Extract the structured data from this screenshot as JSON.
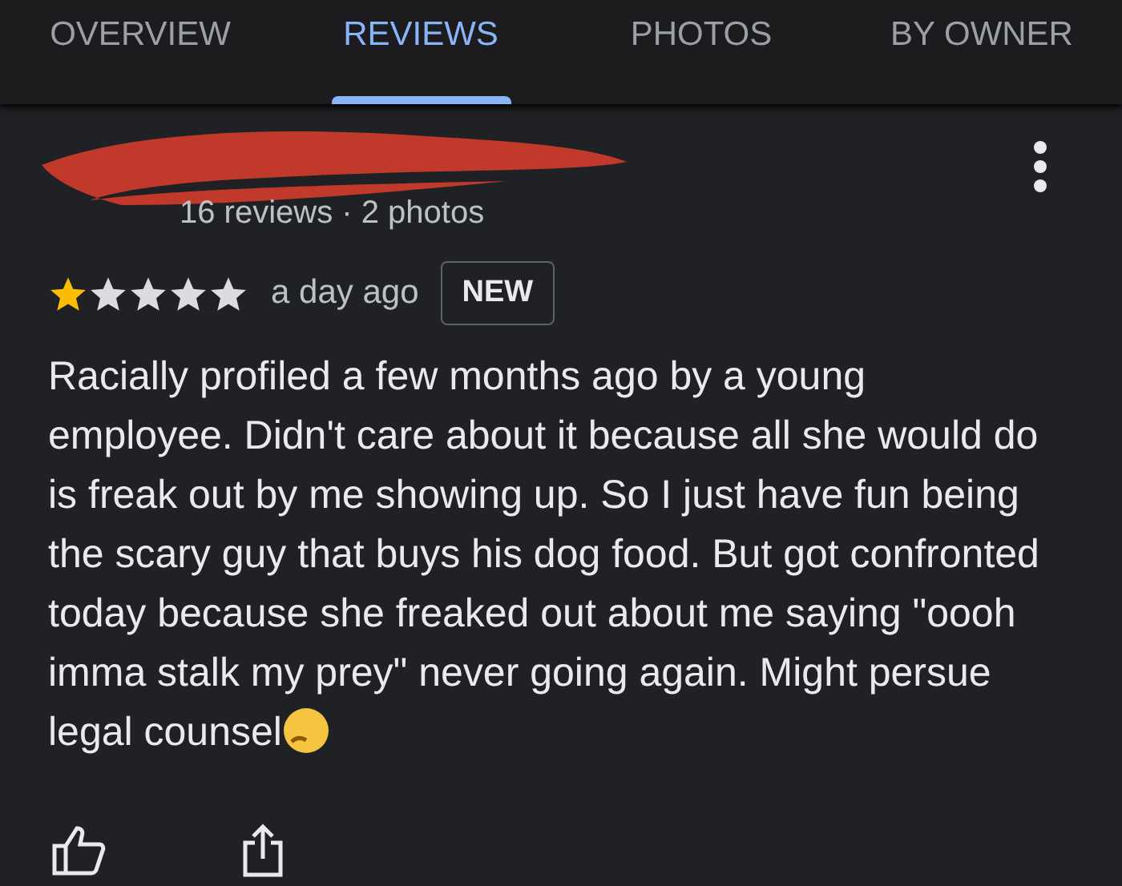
{
  "tabs": [
    {
      "label": "OVERVIEW",
      "selected": false
    },
    {
      "label": "REVIEWS",
      "selected": true
    },
    {
      "label": "PHOTOS",
      "selected": false
    },
    {
      "label": "BY OWNER",
      "selected": false
    }
  ],
  "review": {
    "author_meta": "16 reviews · 2 photos",
    "stars": 1,
    "time": "a day ago",
    "badge": "NEW",
    "text": "Racially profiled a few months ago by a young employee. Didn't care about it because all she would do is freak out by me showing up. So I just have fun being the scary guy that buys his dog food. But got confronted today because she freaked out about me saying \"oooh imma stalk my prey\" never going again. Might persue legal counsel"
  }
}
